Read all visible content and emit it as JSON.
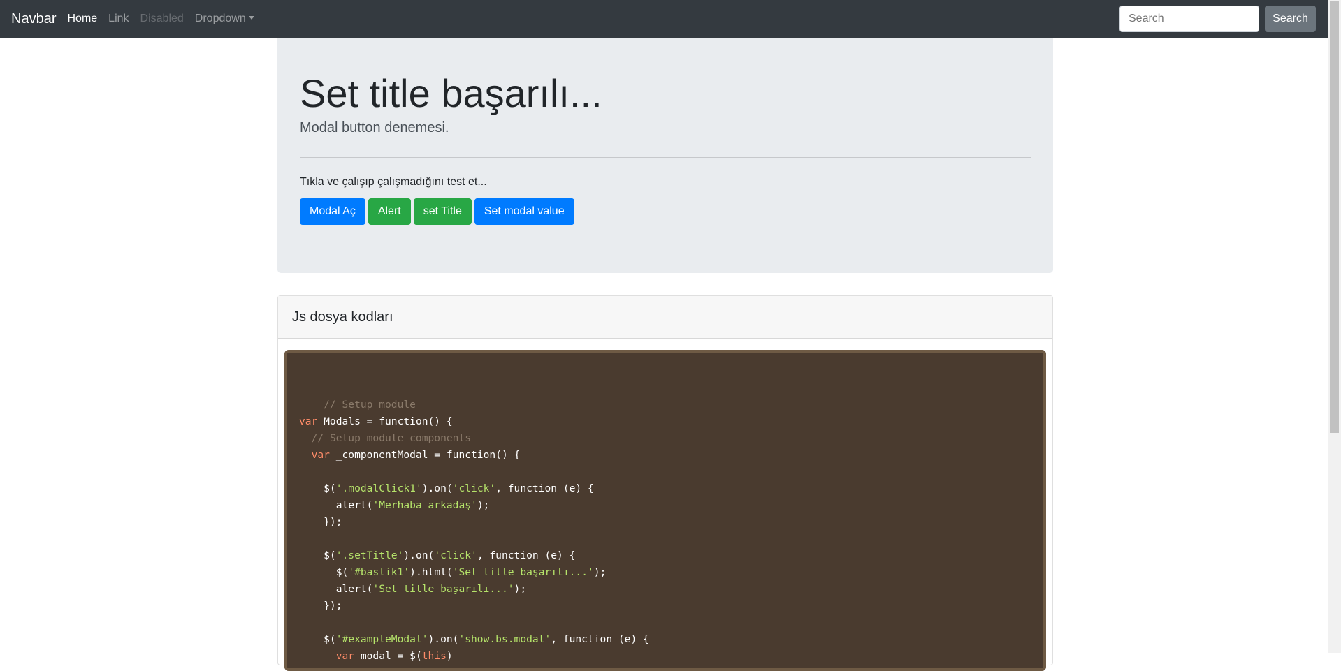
{
  "navbar": {
    "brand": "Navbar",
    "links": [
      {
        "label": "Home"
      },
      {
        "label": "Link"
      },
      {
        "label": "Disabled"
      },
      {
        "label": "Dropdown"
      }
    ],
    "search_placeholder": "Search",
    "search_button": "Search"
  },
  "jumbotron": {
    "title": "Set title başarılı...",
    "lead": "Modal button denemesi.",
    "text": "Tıkla ve çalışıp çalışmadığını test et...",
    "buttons": [
      {
        "label": "Modal Aç",
        "style": "primary"
      },
      {
        "label": "Alert",
        "style": "success"
      },
      {
        "label": "set Title",
        "style": "success"
      },
      {
        "label": "Set modal value",
        "style": "primary"
      }
    ]
  },
  "card": {
    "title": "Js dosya kodları",
    "code_lines": [
      "",
      "    // Setup module",
      "var Modals = function() {",
      "  // Setup module components",
      "  var _componentModal = function() {",
      "",
      "    $('.modalClick1').on('click', function (e) {",
      "      alert('Merhaba arkadaş');",
      "    });",
      "",
      "    $('.setTitle').on('click', function (e) {",
      "      $('#baslik1').html('Set title başarılı...');",
      "      alert('Set title başarılı...');",
      "    });",
      "",
      "    $('#exampleModal').on('show.bs.modal', function (e) {",
      "      var modal = $(this)"
    ]
  },
  "colors": {
    "navbar_bg": "#343a40",
    "primary": "#007bff",
    "success": "#28a745",
    "secondary": "#6c757d",
    "jumbotron_bg": "#e9ecef",
    "code_bg": "#4a3b2f"
  }
}
